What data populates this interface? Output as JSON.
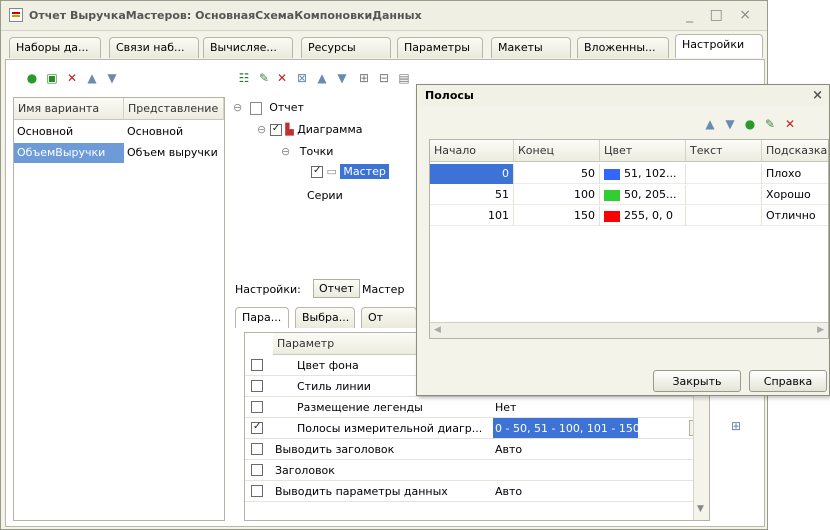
{
  "window": {
    "title": "Отчет ВыручкаМастеров: ОсновнаяСхемаКомпоновкиДанных",
    "controls": "_ □ ×"
  },
  "tabs": [
    {
      "label": "Наборы да..."
    },
    {
      "label": "Связи наб..."
    },
    {
      "label": "Вычисляе..."
    },
    {
      "label": "Ресурсы"
    },
    {
      "label": "Параметры"
    },
    {
      "label": "Макеты"
    },
    {
      "label": "Вложенны..."
    },
    {
      "label": "Настройки"
    }
  ],
  "variants": {
    "headers": [
      "Имя варианта",
      "Представление"
    ],
    "rows": [
      {
        "name": "Основной",
        "repr": "Основной"
      },
      {
        "name": "ОбъемВыручки",
        "repr": "Объем выручки"
      }
    ]
  },
  "tree": {
    "report": "Отчет",
    "chart": "Диаграмма",
    "points": "Точки",
    "master": "Мастер",
    "series": "Серии"
  },
  "settings": {
    "label": "Настройки:",
    "btn_report": "Отчет",
    "btn_master": "Мастер",
    "subtabs": [
      "Пара...",
      "Выбра...",
      "От"
    ]
  },
  "params": {
    "header": "Параметр",
    "rows": [
      {
        "name": "Цвет фона",
        "value": "",
        "checked": false
      },
      {
        "name": "Стиль линии",
        "value": "",
        "checked": false
      },
      {
        "name": "Размещение легенды",
        "value": "Нет",
        "checked": false
      },
      {
        "name": "Полосы измерительной диагр...",
        "value": "0 - 50, 51 - 100, 101 - 150",
        "checked": true
      },
      {
        "name": "Выводить заголовок",
        "value": "Авто",
        "checked": false
      },
      {
        "name": "Заголовок",
        "value": "",
        "checked": false
      },
      {
        "name": "Выводить параметры данных",
        "value": "Авто",
        "checked": false
      }
    ],
    "ellipsis": "..."
  },
  "dialog": {
    "title": "Полосы",
    "close_glyph": "×",
    "headers": [
      "Начало",
      "Конец",
      "Цвет",
      "Текст",
      "Подсказка"
    ],
    "rows": [
      {
        "start": "0",
        "end": "50",
        "color_text": "51, 102...",
        "color": "#3366ff",
        "text": "",
        "hint": "Плохо"
      },
      {
        "start": "51",
        "end": "100",
        "color_text": "50, 205...",
        "color": "#32cd32",
        "text": "",
        "hint": "Хорошо"
      },
      {
        "start": "101",
        "end": "150",
        "color_text": "255, 0, 0",
        "color": "#ff0000",
        "text": "",
        "hint": "Отлично"
      }
    ],
    "close_button": "Закрыть",
    "help_button": "Справка"
  },
  "colors": {
    "selection": "#6d9bd8",
    "highlight": "#3d73d6"
  }
}
